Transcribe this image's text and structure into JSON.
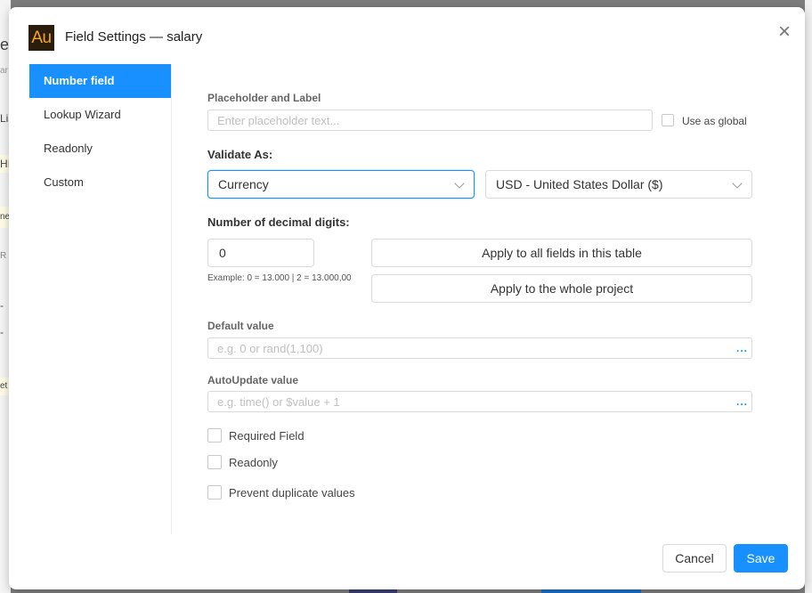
{
  "background": {
    "fragments": [
      "e",
      "ar",
      "Lis",
      "HI",
      "ne",
      "R",
      "-",
      "-",
      "et"
    ]
  },
  "modal": {
    "logo_text": "Au",
    "title": "Field Settings — salary",
    "close_symbol": "×"
  },
  "sidebar": {
    "items": [
      {
        "label": "Number field",
        "active": true
      },
      {
        "label": "Lookup Wizard",
        "active": false
      },
      {
        "label": "Readonly",
        "active": false
      },
      {
        "label": "Custom",
        "active": false
      }
    ]
  },
  "placeholder_section": {
    "label": "Placeholder and Label",
    "input_placeholder": "Enter placeholder text...",
    "input_value": "",
    "use_global_label": "Use as global",
    "use_global_checked": false
  },
  "validate": {
    "label": "Validate As:",
    "type_value": "Currency",
    "currency_value": "USD - United States Dollar ($)"
  },
  "decimals": {
    "label": "Number of decimal digits:",
    "value": "0",
    "example": "Example: 0 = 13.000 | 2 = 13.000,00",
    "apply_table_label": "Apply to all fields in this table",
    "apply_project_label": "Apply to the whole project"
  },
  "default_value": {
    "label": "Default value",
    "placeholder": "e.g. 0 or rand(1,100)",
    "value": "",
    "more": "..."
  },
  "autoupdate_value": {
    "label": "AutoUpdate value",
    "placeholder": "e.g. time() or $value + 1",
    "value": "",
    "more": "..."
  },
  "options": [
    {
      "label": "Required Field",
      "checked": false
    },
    {
      "label": "Readonly",
      "checked": false
    },
    {
      "label": "Prevent duplicate values",
      "checked": false
    }
  ],
  "footer": {
    "cancel_label": "Cancel",
    "save_label": "Save"
  },
  "colors": {
    "accent": "#1890ff",
    "overlay": "#7d7d7d"
  }
}
